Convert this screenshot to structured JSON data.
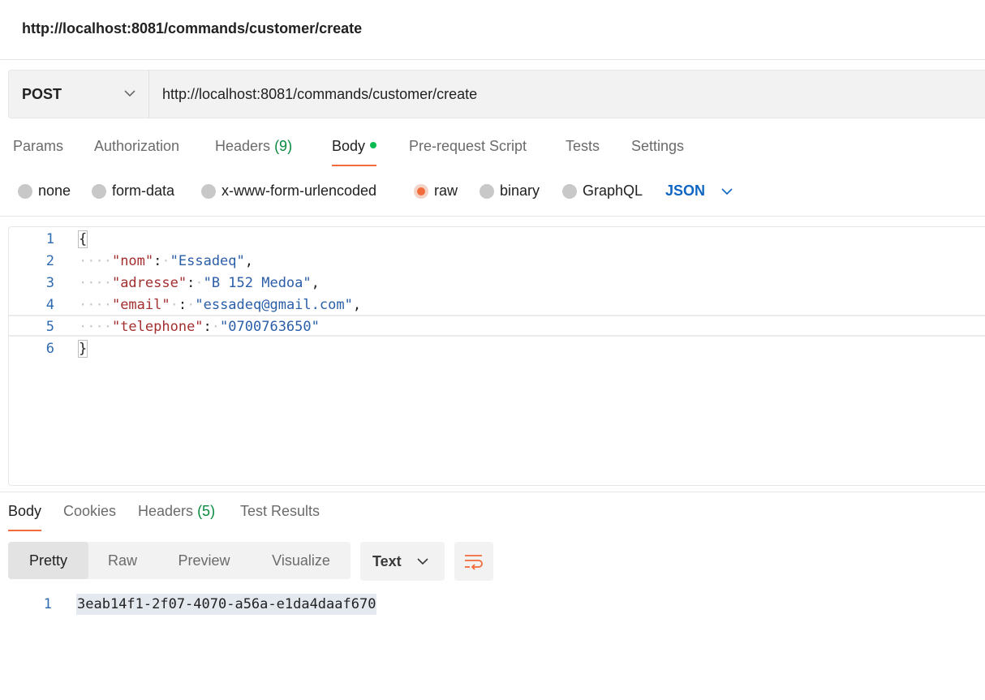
{
  "window": {
    "title": "http://localhost:8081/commands/customer/create"
  },
  "request": {
    "method": "POST",
    "url": "http://localhost:8081/commands/customer/create"
  },
  "request_tabs": [
    {
      "label": "Params"
    },
    {
      "label": "Authorization"
    },
    {
      "label": "Headers",
      "count": "(9)"
    },
    {
      "label": "Body",
      "active": true
    },
    {
      "label": "Pre-request Script"
    },
    {
      "label": "Tests"
    },
    {
      "label": "Settings"
    }
  ],
  "body_types": [
    {
      "label": "none"
    },
    {
      "label": "form-data"
    },
    {
      "label": "x-www-form-urlencoded"
    },
    {
      "label": "raw",
      "selected": true
    },
    {
      "label": "binary"
    },
    {
      "label": "GraphQL"
    }
  ],
  "body_language": "JSON",
  "editor": {
    "lines": [
      {
        "number": "1",
        "text": "{"
      },
      {
        "number": "2",
        "key": "\"nom\"",
        "value": "\"Essadeq\""
      },
      {
        "number": "3",
        "key": "\"adresse\"",
        "value": "\"B 152 Medoa\""
      },
      {
        "number": "4",
        "key": "\"email\"",
        "value": "\"essadeq@gmail.com\""
      },
      {
        "number": "5",
        "key": "\"telephone\"",
        "value": "\"0700763650\""
      },
      {
        "number": "6",
        "text": "}"
      }
    ]
  },
  "response_tabs": [
    {
      "label": "Body",
      "active": true
    },
    {
      "label": "Cookies"
    },
    {
      "label": "Headers",
      "count": "(5)"
    },
    {
      "label": "Test Results"
    }
  ],
  "response_views": [
    {
      "label": "Pretty",
      "active": true
    },
    {
      "label": "Raw"
    },
    {
      "label": "Preview"
    },
    {
      "label": "Visualize"
    }
  ],
  "response_format": "Text",
  "response_body": {
    "number": "1",
    "text": "3eab14f1-2f07-4070-a56a-e1da4daaf670"
  },
  "colors": {
    "accent": "#f26b3a",
    "link_blue": "#0f66c2",
    "count_green": "#0b8a3e",
    "status_dot": "#0cbb52"
  },
  "icons": {
    "method_dropdown": "chevron-down-icon",
    "language_dropdown": "chevron-down-icon",
    "format_dropdown": "chevron-down-icon",
    "wrap": "wrap-lines-icon"
  }
}
